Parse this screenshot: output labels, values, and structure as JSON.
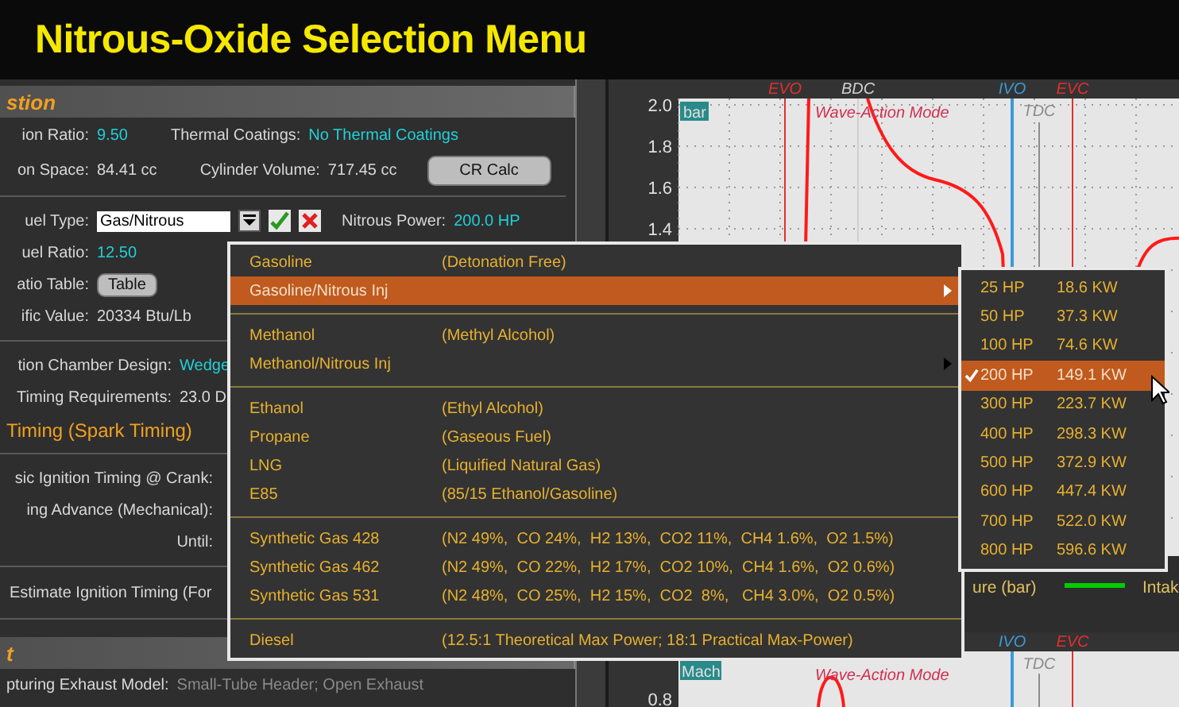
{
  "title": "Nitrous-Oxide Selection Menu",
  "panel": {
    "section_1": "stion",
    "compression_ratio": {
      "label": "ion Ratio:",
      "value": "9.50"
    },
    "thermal_coatings": {
      "label": "Thermal Coatings:",
      "value": "No Thermal Coatings"
    },
    "combustion_space": {
      "label": "on Space:",
      "value": "84.41 cc"
    },
    "cylinder_volume": {
      "label": "Cylinder Volume:",
      "value": "717.45 cc"
    },
    "cr_calc_button": "CR Calc",
    "fuel_type": {
      "label": "uel Type:",
      "value": "Gas/Nitrous"
    },
    "nitrous_power": {
      "label": "Nitrous Power:",
      "value": "200.0 HP"
    },
    "fuel_ratio": {
      "label": "uel Ratio:",
      "value": "12.50"
    },
    "ratio_table": {
      "label": "atio Table:",
      "button": "Table"
    },
    "specific_value": {
      "label": "ific Value:",
      "value": "20334 Btu/Lb"
    },
    "chamber_design": {
      "label": "tion Chamber Design:",
      "value": "Wedge"
    },
    "timing_requirements": {
      "label": "Timing Requirements:",
      "value": "23.0 D"
    },
    "section_2": "Timing (Spark Timing)",
    "basic_timing_label": "sic Ignition Timing @ Crank:",
    "advance_label": "ing Advance (Mechanical):",
    "until_label": "Until:",
    "estimate_button": "Estimate Ignition Timing (For",
    "section_3": "t",
    "exhaust_model": {
      "label": "pturing Exhaust Model:",
      "value": "Small-Tube Header;  Open Exhaust"
    }
  },
  "chart_1": {
    "y_ticks": [
      "2.0",
      "1.8",
      "1.6",
      "1.4"
    ],
    "unit_badge": "bar",
    "mode_label": "Wave-Action Mode",
    "markers": [
      {
        "label": "EVO",
        "color": "#e03030"
      },
      {
        "label": "BDC",
        "color": "#d0d0d0"
      },
      {
        "label": "IVO",
        "color": "#3a9ad8"
      },
      {
        "label": "TDC",
        "color": "#8c8c8c"
      },
      {
        "label": "EVC",
        "color": "#e03030"
      }
    ],
    "legend": [
      {
        "label": "ure (bar)"
      },
      {
        "label": "Intak",
        "color": "#00cc00"
      }
    ]
  },
  "chart_2": {
    "y_ticks": [
      "0.8"
    ],
    "unit_badge": "Mach",
    "mode_label": "Wave-Action Mode",
    "markers": [
      {
        "label": "IVO",
        "color": "#3a9ad8"
      },
      {
        "label": "TDC",
        "color": "#8c8c8c"
      },
      {
        "label": "EVC",
        "color": "#e03030"
      }
    ]
  },
  "fuel_menu": [
    {
      "kind": "item",
      "name": "Gasoline",
      "description": "(Detonation Free)",
      "has_submenu": false,
      "selected": false
    },
    {
      "kind": "item",
      "name": "Gasoline/Nitrous Inj",
      "has_submenu": true,
      "selected": true
    },
    {
      "kind": "separator"
    },
    {
      "kind": "item",
      "name": "Methanol",
      "description": "(Methyl Alcohol)",
      "has_submenu": false,
      "selected": false
    },
    {
      "kind": "item",
      "name": "Methanol/Nitrous Inj",
      "has_submenu": true,
      "selected": false
    },
    {
      "kind": "separator"
    },
    {
      "kind": "item",
      "name": "Ethanol",
      "description": "(Ethyl Alcohol)",
      "has_submenu": false,
      "selected": false
    },
    {
      "kind": "item",
      "name": "Propane",
      "description": "(Gaseous Fuel)",
      "has_submenu": false,
      "selected": false
    },
    {
      "kind": "item",
      "name": "LNG",
      "description": "(Liquified Natural Gas)",
      "has_submenu": false,
      "selected": false
    },
    {
      "kind": "item",
      "name": "E85",
      "description": "(85/15 Ethanol/Gasoline)",
      "has_submenu": false,
      "selected": false
    },
    {
      "kind": "separator"
    },
    {
      "kind": "item",
      "name": "Synthetic Gas 428",
      "description": "(N2 49%,  CO 24%,  H2 13%,  CO2 11%,  CH4 1.6%,  O2 1.5%)",
      "has_submenu": false,
      "selected": false
    },
    {
      "kind": "item",
      "name": "Synthetic Gas 462",
      "description": "(N2 49%,  CO 22%,  H2 17%,  CO2 10%,  CH4 1.6%,  O2 0.6%)",
      "has_submenu": false,
      "selected": false
    },
    {
      "kind": "item",
      "name": "Synthetic Gas 531",
      "description": "(N2 48%,  CO 25%,  H2 15%,  CO2  8%,   CH4 3.0%,  O2 0.5%)",
      "has_submenu": false,
      "selected": false
    },
    {
      "kind": "separator"
    },
    {
      "kind": "item",
      "name": "Diesel",
      "description": "(12.5:1 Theoretical Max Power; 18:1 Practical Max-Power)",
      "has_submenu": false,
      "selected": false
    }
  ],
  "power_submenu": [
    {
      "hp": "25 HP",
      "kw": "18.6 KW",
      "checked": false,
      "selected": false
    },
    {
      "hp": "50 HP",
      "kw": "37.3 KW",
      "checked": false,
      "selected": false
    },
    {
      "hp": "100 HP",
      "kw": "74.6 KW",
      "checked": false,
      "selected": false
    },
    {
      "hp": "200 HP",
      "kw": "149.1 KW",
      "checked": true,
      "selected": true
    },
    {
      "hp": "300 HP",
      "kw": "223.7 KW",
      "checked": false,
      "selected": false
    },
    {
      "hp": "400 HP",
      "kw": "298.3 KW",
      "checked": false,
      "selected": false
    },
    {
      "hp": "500 HP",
      "kw": "372.9 KW",
      "checked": false,
      "selected": false
    },
    {
      "hp": "600 HP",
      "kw": "447.4 KW",
      "checked": false,
      "selected": false
    },
    {
      "hp": "700 HP",
      "kw": "522.0 KW",
      "checked": false,
      "selected": false
    },
    {
      "hp": "800 HP",
      "kw": "596.6 KW",
      "checked": false,
      "selected": false
    }
  ]
}
